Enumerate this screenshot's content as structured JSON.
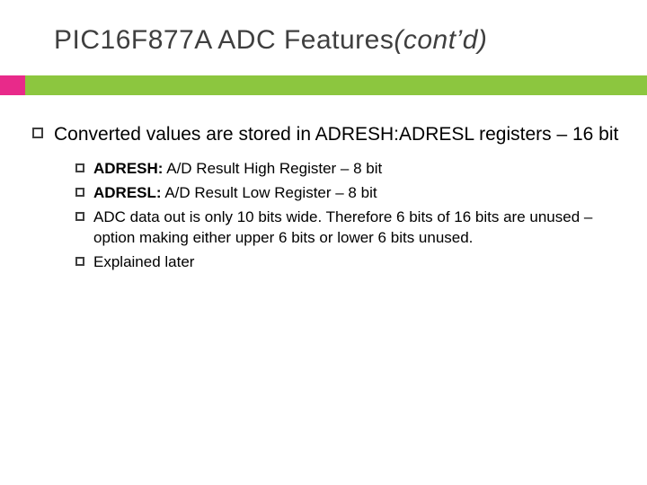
{
  "title_main": "PIC16F877A ADC Features",
  "title_cont": "(cont’d)",
  "main_bullet": "Converted values are stored in ADRESH:ADRESL registers – 16 bit",
  "sub": [
    {
      "bold": "ADRESH:",
      "rest": " A/D Result High Register – 8 bit"
    },
    {
      "bold": "ADRESL:",
      "rest": " A/D Result Low Register – 8 bit"
    },
    {
      "bold": "",
      "rest": "ADC data out is only 10 bits wide. Therefore 6 bits of 16 bits are unused – option making either upper 6 bits or lower 6 bits unused."
    },
    {
      "bold": "",
      "rest": "Explained later"
    }
  ]
}
